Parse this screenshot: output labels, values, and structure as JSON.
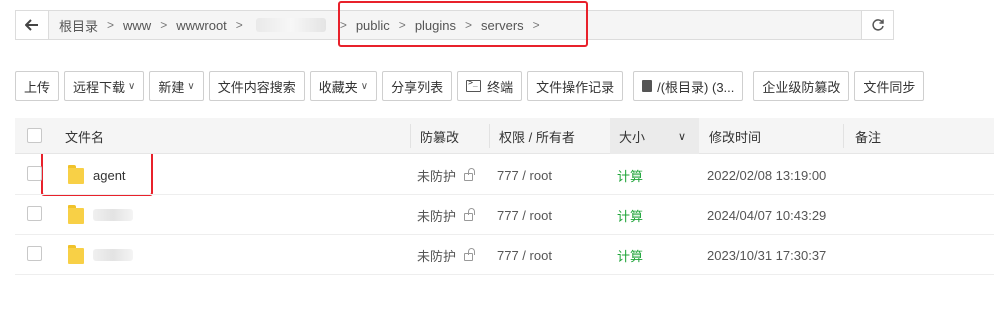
{
  "pathbar": {
    "crumbs": [
      "根目录",
      "www",
      "wwwroot",
      "public",
      "plugins",
      "servers"
    ]
  },
  "toolbar": {
    "upload": "上传",
    "remote_download": "远程下载",
    "new": "新建",
    "content_search": "文件内容搜索",
    "favorites": "收藏夹",
    "share_list": "分享列表",
    "terminal": "终端",
    "file_log": "文件操作记录",
    "disk": "/(根目录) (3...",
    "tamper_proof": "企业级防篡改",
    "sync": "文件同步"
  },
  "table": {
    "columns": [
      "文件名",
      "防篡改",
      "权限 / 所有者",
      "大小",
      "修改时间",
      "备注"
    ],
    "rows": [
      {
        "name": "agent",
        "tamper": "未防护",
        "perm": "777 / root",
        "size": "计算",
        "mtime": "2022/02/08 13:19:00"
      },
      {
        "name": "",
        "tamper": "未防护",
        "perm": "777 / root",
        "size": "计算",
        "mtime": "2024/04/07 10:43:29"
      },
      {
        "name": "",
        "tamper": "未防护",
        "perm": "777 / root",
        "size": "计算",
        "mtime": "2023/10/31 17:30:37"
      }
    ]
  },
  "colors": {
    "highlight": "#e8212b",
    "calc": "#20a53a",
    "folder": "#f8d046"
  }
}
